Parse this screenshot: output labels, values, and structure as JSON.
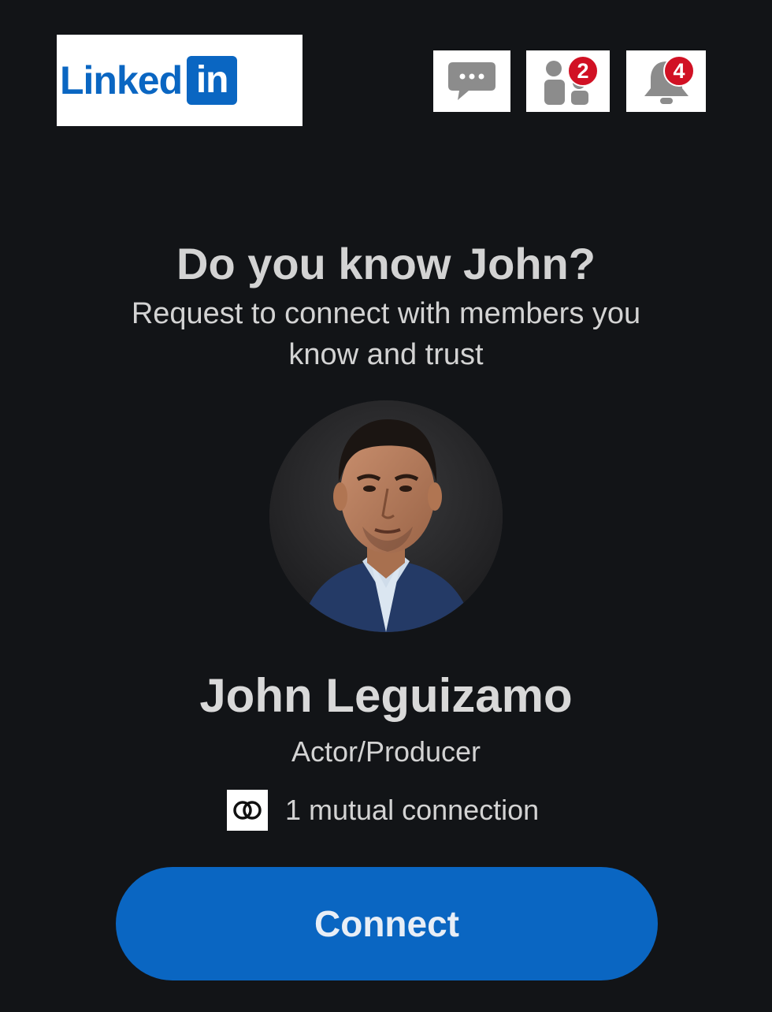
{
  "header": {
    "logo": {
      "word": "Linked",
      "mark": "in",
      "brand_color": "#0a66c2"
    },
    "icons": [
      {
        "name": "messaging-icon"
      },
      {
        "name": "my-network-icon",
        "badge": "2"
      },
      {
        "name": "notifications-icon",
        "badge": "4"
      }
    ],
    "badge_color": "#d11124"
  },
  "prompt": {
    "title": "Do you know John?",
    "subtitle": "Request to connect with members you know and trust"
  },
  "profile": {
    "name": "John Leguizamo",
    "headline": "Actor/Producer",
    "mutual": "1 mutual connection"
  },
  "actions": {
    "connect_label": "Connect",
    "connect_color": "#0a66c2"
  }
}
